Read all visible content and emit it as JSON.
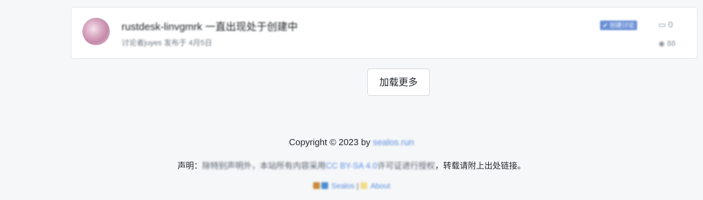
{
  "topic": {
    "title": "rustdesk-linvgmrk 一直出现处于创建中",
    "meta": "讨论者juyes 发布于 4月5日",
    "tag": "✔ 创建讨论",
    "reply_icon": "comment-icon",
    "reply_count": "0",
    "view_icon": "eye-icon",
    "view_count": "88"
  },
  "load_more_label": "加载更多",
  "footer": {
    "copyright_prefix": "Copyright © 2023 by",
    "site": "sealos.run",
    "statement_prefix": "声明：",
    "statement_blur1": "除特别声明外，",
    "statement_blur2": "本站所有内容采用",
    "license": "CC BY-SA 4.0",
    "statement_blur3": "许可证进行授权",
    "statement_suffix": "，转载请附上出处链接。",
    "link1": "Sealos",
    "separator": "|",
    "link2": "About"
  }
}
